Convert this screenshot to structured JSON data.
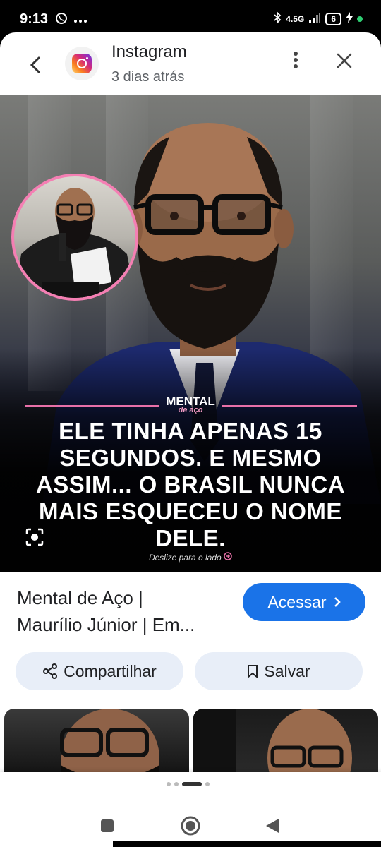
{
  "status_bar": {
    "time": "9:13",
    "network": "4.5G",
    "battery": "6"
  },
  "header": {
    "app_name": "Instagram",
    "subtitle": "3 dias atrás"
  },
  "hero": {
    "brand_top": "MENTAL",
    "brand_bottom": "de aço",
    "headline_lines": [
      "ELE TINHA APENAS 15",
      "SEGUNDOS. E MESMO",
      "ASSIM... O BRASIL NUNCA",
      "MAIS ESQUECEU O NOME",
      "DELE."
    ],
    "swipe_hint": "Deslize para o lado"
  },
  "result": {
    "title_line1": "Mental de Aço |",
    "title_line2": "Maurílio Júnior | Em...",
    "visit_label": "Acessar"
  },
  "actions": {
    "share_label": "Compartilhar",
    "save_label": "Salvar"
  },
  "colors": {
    "accent": "#1a73e8",
    "pill_bg": "#e8eef8",
    "brand_pink": "#e870a8"
  },
  "icons": [
    "whatsapp-icon",
    "more-icon",
    "bluetooth-icon",
    "signal-icon",
    "battery-icon",
    "charging-icon",
    "back-icon",
    "instagram-icon",
    "more-vert-icon",
    "close-icon",
    "lens-icon",
    "chevron-right-icon",
    "share-icon",
    "bookmark-icon",
    "square-icon",
    "home-icon",
    "back-triangle-icon"
  ]
}
